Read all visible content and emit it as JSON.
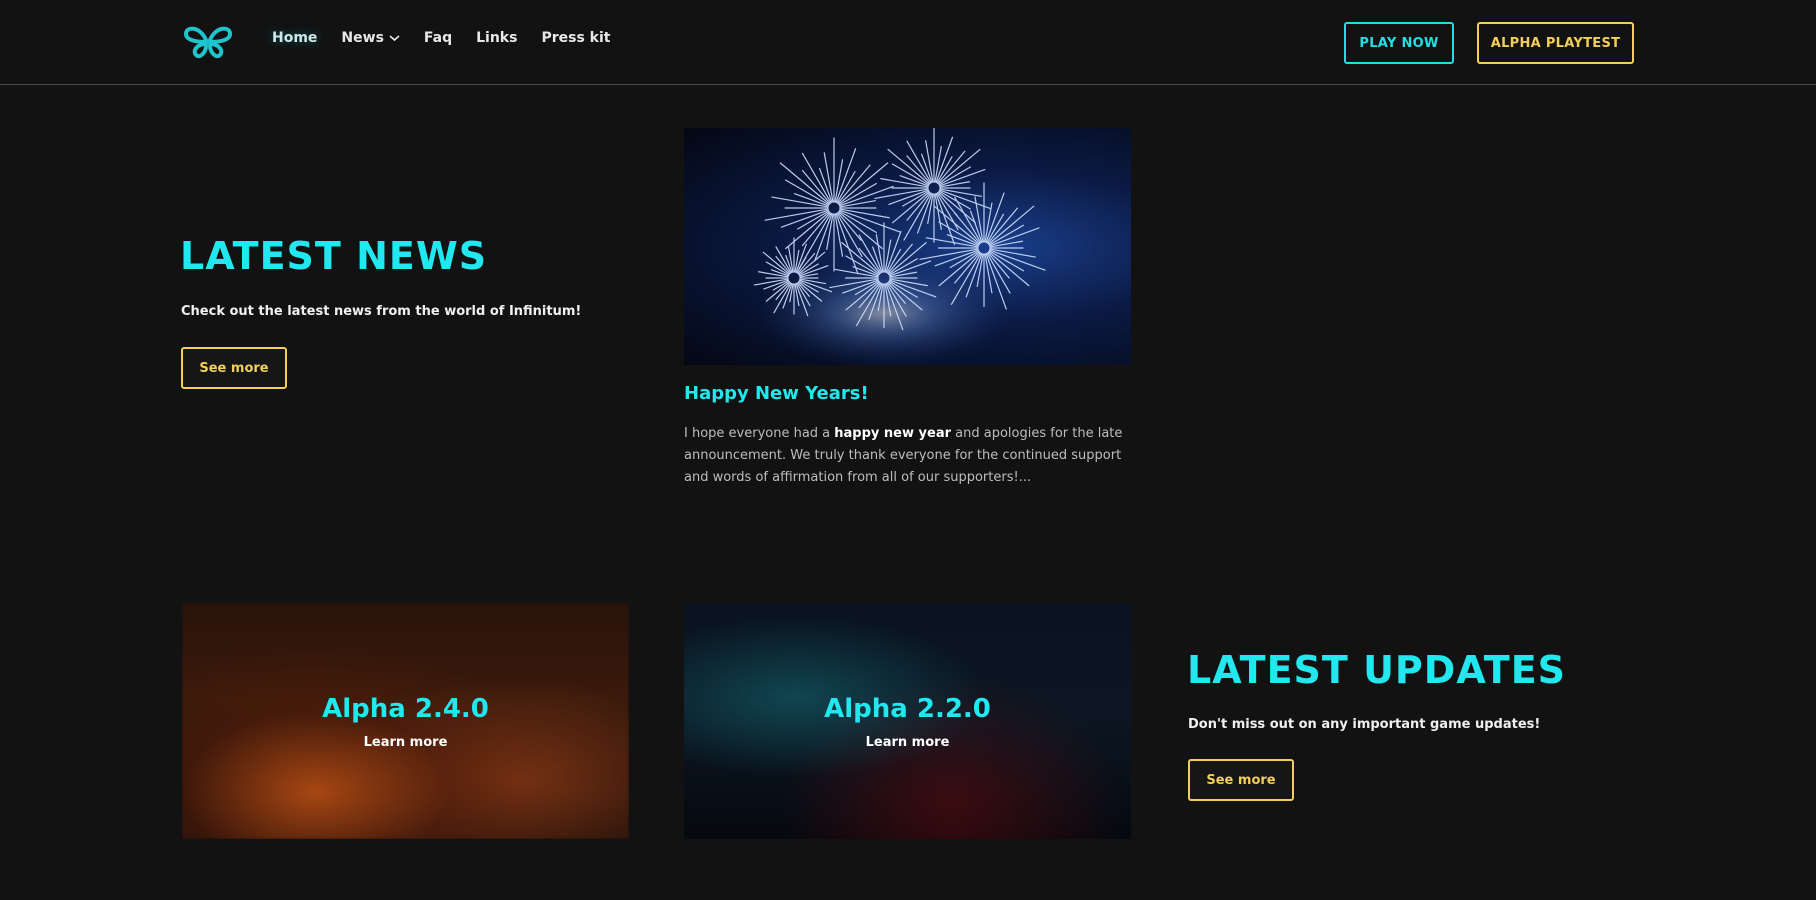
{
  "header": {
    "logo_icon": "butterfly-logo-icon",
    "nav": [
      {
        "label": "Home",
        "active": true
      },
      {
        "label": "News",
        "has_dropdown": true
      },
      {
        "label": "Faq"
      },
      {
        "label": "Links"
      },
      {
        "label": "Press kit"
      }
    ],
    "play_now": "PLAY NOW",
    "alpha_playtest": "ALPHA PLAYTEST"
  },
  "latest_news": {
    "title": "LATEST NEWS",
    "description": "Check out the latest news from the world of Infinitum!",
    "see_more": "See more",
    "article": {
      "image": "fireworks-image",
      "title": "Happy New Years!",
      "excerpt_pre": "I hope everyone had a ",
      "excerpt_bold": "happy new year",
      "excerpt_post": " and apologies for the late announcement. We truly thank everyone for the continued support and words of affirmation from all of our supporters!..."
    }
  },
  "latest_updates": {
    "title": "LATEST UPDATES",
    "description": "Don't miss out on any important game updates!",
    "see_more": "See more",
    "cards": [
      {
        "title": "Alpha 2.4.0",
        "link": "Learn more"
      },
      {
        "title": "Alpha 2.2.0",
        "link": "Learn more"
      }
    ]
  },
  "colors": {
    "accent_cyan": "#20e8ee",
    "accent_gold": "#f2cf5a",
    "background": "#121212"
  }
}
